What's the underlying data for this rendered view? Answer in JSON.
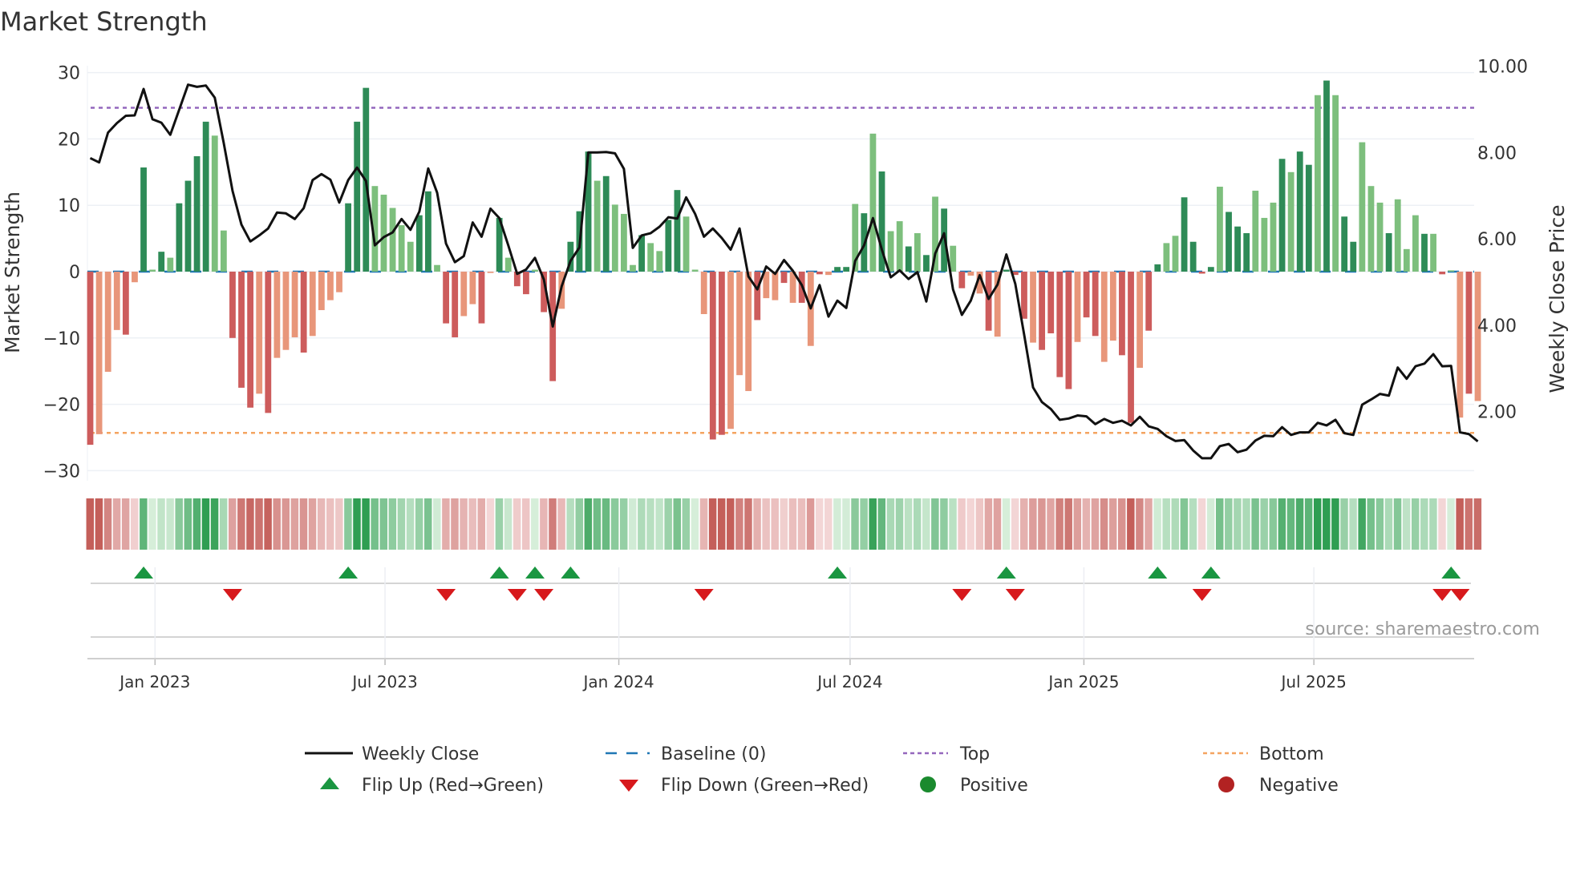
{
  "chart_data": {
    "type": "bar",
    "title": "Market Strength",
    "ylabel": "Market Strength",
    "ylabel_right": "Weekly Close Price",
    "source": "source: sharemaestro.com",
    "ylim": [
      -30,
      30
    ],
    "y_ticks": [
      30,
      20,
      10,
      0,
      -10,
      -20,
      -30
    ],
    "y_tick_labels": [
      "30",
      "20",
      "10",
      "0",
      "−10",
      "−20",
      "−30"
    ],
    "ylim_right": [
      0,
      10
    ],
    "y_right_ticks": [
      10,
      8,
      6,
      4,
      2
    ],
    "y_right_tick_labels": [
      "10.00",
      "8.00",
      "6.00",
      "4.00",
      "2.00"
    ],
    "x_start_date": "2022-11-11",
    "x_frequency": "weekly",
    "x_tick_dates": [
      "2023-01-01",
      "2023-07-01",
      "2024-01-01",
      "2024-07-01",
      "2025-01-01",
      "2025-07-01"
    ],
    "x_tick_labels": [
      "Jan 2023",
      "Jul 2023",
      "Jan 2024",
      "Jul 2024",
      "Jan 2025",
      "Jul 2025"
    ],
    "grid": true,
    "top_level": 24.7,
    "bottom_level": -24.3,
    "colors": {
      "pos_strong": "#2e8b57",
      "pos_weak": "#7dbf7d",
      "neg_strong": "#cd5c5c",
      "neg_weak": "#e8967a",
      "price": "#111111",
      "baseline": "#1f77b4",
      "top": "#9467bd",
      "bottom": "#f4a460",
      "flip_up": "#1a9641",
      "flip_down": "#d7191c",
      "positive": "#1a8a2e",
      "negative": "#b22222"
    },
    "strength": [
      -26.1,
      -24.5,
      -15.1,
      -8.8,
      -9.5,
      -1.6,
      15.7,
      0.3,
      3.0,
      2.1,
      10.3,
      13.7,
      17.4,
      22.6,
      20.5,
      6.2,
      -10.0,
      -17.5,
      -20.5,
      -18.4,
      -21.3,
      -13.0,
      -11.8,
      -9.9,
      -12.2,
      -9.7,
      -5.8,
      -4.3,
      -3.1,
      10.3,
      22.6,
      27.7,
      12.9,
      11.6,
      9.6,
      7.0,
      4.5,
      8.5,
      12.1,
      1.0,
      -7.8,
      -9.9,
      -6.7,
      -4.9,
      -7.8,
      -0.2,
      8.1,
      2.1,
      -2.2,
      -3.4,
      0.3,
      -6.1,
      -16.5,
      -5.6,
      4.5,
      9.1,
      18.1,
      13.7,
      14.4,
      10.1,
      8.7,
      1.0,
      5.5,
      4.3,
      3.1,
      7.8,
      12.3,
      8.3,
      0.3,
      -6.4,
      -25.3,
      -24.6,
      -23.7,
      -15.6,
      -18.0,
      -7.3,
      -4.0,
      -4.3,
      -1.7,
      -4.7,
      -4.7,
      -11.2,
      -0.4,
      -0.5,
      0.7,
      0.7,
      10.2,
      8.8,
      20.8,
      15.1,
      6.1,
      7.6,
      3.8,
      5.8,
      2.5,
      11.3,
      9.5,
      3.9,
      -2.5,
      -0.6,
      -3.3,
      -8.9,
      -9.8,
      0.3,
      -0.5,
      -7.1,
      -10.7,
      -11.8,
      -9.3,
      -15.9,
      -17.7,
      -10.6,
      -6.9,
      -9.7,
      -13.6,
      -10.4,
      -12.6,
      -22.8,
      -14.5,
      -8.9,
      1.1,
      4.3,
      5.4,
      11.2,
      4.5,
      -0.3,
      0.7,
      12.8,
      9.0,
      6.8,
      5.8,
      12.2,
      8.1,
      10.4,
      17.0,
      15.0,
      18.1,
      16.1,
      26.6,
      28.8,
      26.6,
      8.3,
      4.5,
      19.5,
      12.9,
      10.4,
      5.8,
      10.9,
      3.4,
      8.5,
      5.7,
      5.7,
      -0.4,
      0.2,
      -22.0,
      -18.4,
      -19.5
    ],
    "strength_shade": "dllldldldlddddlldddldllldlllldddlllllddlddlldldlddlddldddldllldllddlllddllldlldldldlddldldlldldldldlldldddlddddlddllddlddllddddldddllldlddldlddllldllldldlldldld",
    "weekly_close": [
      7.87,
      7.77,
      8.46,
      8.68,
      8.85,
      8.86,
      9.47,
      8.77,
      8.69,
      8.41,
      8.99,
      9.57,
      9.52,
      9.55,
      9.27,
      8.23,
      7.11,
      6.33,
      5.94,
      6.08,
      6.24,
      6.61,
      6.59,
      6.46,
      6.71,
      7.36,
      7.5,
      7.37,
      6.84,
      7.36,
      7.65,
      7.34,
      5.85,
      6.04,
      6.15,
      6.46,
      6.21,
      6.63,
      7.63,
      7.07,
      5.89,
      5.46,
      5.6,
      6.38,
      6.05,
      6.7,
      6.48,
      5.85,
      5.19,
      5.29,
      5.56,
      5.06,
      3.97,
      4.9,
      5.49,
      5.8,
      8.0,
      8.0,
      8.01,
      7.98,
      7.62,
      5.79,
      6.08,
      6.13,
      6.28,
      6.5,
      6.47,
      6.96,
      6.58,
      6.05,
      6.24,
      6.02,
      5.75,
      6.24,
      5.13,
      4.83,
      5.36,
      5.19,
      5.51,
      5.26,
      4.93,
      4.39,
      4.93,
      4.2,
      4.57,
      4.4,
      5.49,
      5.85,
      6.48,
      5.75,
      5.11,
      5.27,
      5.07,
      5.23,
      4.55,
      5.66,
      6.13,
      4.83,
      4.24,
      4.57,
      5.16,
      4.61,
      4.94,
      5.64,
      4.96,
      3.78,
      2.56,
      2.22,
      2.06,
      1.81,
      1.84,
      1.91,
      1.89,
      1.71,
      1.83,
      1.74,
      1.79,
      1.68,
      1.88,
      1.66,
      1.6,
      1.43,
      1.32,
      1.34,
      1.1,
      0.92,
      0.92,
      1.2,
      1.25,
      1.06,
      1.12,
      1.33,
      1.44,
      1.43,
      1.64,
      1.46,
      1.52,
      1.52,
      1.74,
      1.68,
      1.81,
      1.5,
      1.46,
      2.16,
      2.28,
      2.41,
      2.37,
      3.02,
      2.76,
      3.05,
      3.11,
      3.33,
      3.05,
      3.06,
      1.52,
      1.48,
      1.31
    ],
    "flip_up_index": [
      6,
      29,
      46,
      50,
      54,
      84,
      103,
      120,
      126,
      153
    ],
    "flip_down_index": [
      16,
      40,
      48,
      51,
      69,
      98,
      104,
      125,
      152,
      154
    ],
    "legend_position": "bottom",
    "legend": {
      "weekly_close": "Weekly Close",
      "baseline": "Baseline (0)",
      "top": "Top",
      "bottom": "Bottom",
      "flip_up": "Flip Up (Red→Green)",
      "flip_down": "Flip Down (Green→Red)",
      "positive": "Positive",
      "negative": "Negative"
    }
  }
}
